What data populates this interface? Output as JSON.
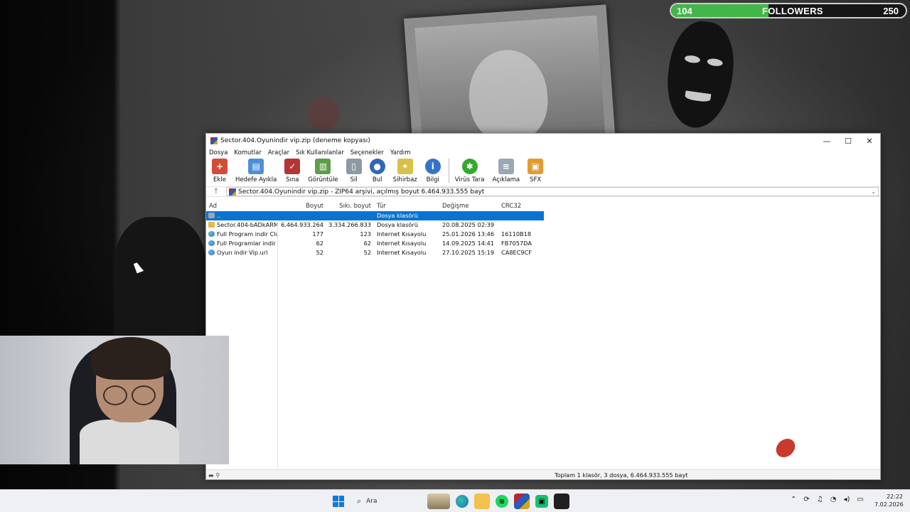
{
  "follower_bar": {
    "current": "104",
    "label": "FOLLOWERS",
    "goal": "250",
    "progress_fraction": 0.416
  },
  "window": {
    "title": "Sector.404.Oyunindir vip.zip (deneme kopyası)",
    "controls": {
      "minimize": "—",
      "maximize": "☐",
      "close": "✕"
    }
  },
  "menu": [
    "Dosya",
    "Komutlar",
    "Araçlar",
    "Sık Kullanılanlar",
    "Seçenekler",
    "Yardım"
  ],
  "toolbar": [
    {
      "label": "Ekle",
      "icon": "add-archive-icon",
      "color": "#d44b36"
    },
    {
      "label": "Hedefe Ayıkla",
      "icon": "extract-folder-icon",
      "color": "#4f8fd8"
    },
    {
      "label": "Sına",
      "icon": "test-clipboard-icon",
      "color": "#b63434"
    },
    {
      "label": "Görüntüle",
      "icon": "view-book-icon",
      "color": "#5c9e4a"
    },
    {
      "label": "Sil",
      "icon": "trash-icon",
      "color": "#8d9aa6"
    },
    {
      "label": "Bul",
      "icon": "find-magnifier-icon",
      "color": "#2f67b8"
    },
    {
      "label": "Sihirbaz",
      "icon": "wizard-wand-icon",
      "color": "#d8c04a"
    },
    {
      "label": "Bilgi",
      "icon": "info-icon",
      "color": "#3574c7"
    },
    {
      "label": "Virüs Tara",
      "icon": "virus-scan-icon",
      "color": "#35a82f"
    },
    {
      "label": "Açıklama",
      "icon": "comment-icon",
      "color": "#9aa8b6"
    },
    {
      "label": "SFX",
      "icon": "sfx-box-icon",
      "color": "#e39b2f"
    }
  ],
  "address": "Sector.404.Oyunindir vip.zip - ZIP64 arşivi, açılmış boyut 6.464.933.555 bayt",
  "columns": {
    "name": "Ad",
    "size": "Boyut",
    "packed": "Sıkı. boyut",
    "type": "Tür",
    "modified": "Değişme",
    "crc": "CRC32"
  },
  "files": [
    {
      "name": "..",
      "size": "",
      "packed": "",
      "type": "Dosya klasörü",
      "modified": "",
      "crc": "",
      "icon": "folder-up",
      "selected": true
    },
    {
      "name": "Sector.404-bADkARMA",
      "size": "6.464.933.264",
      "packed": "3.334.266.833",
      "type": "Dosya klasörü",
      "modified": "20.08.2025 02:39",
      "crc": "",
      "icon": "folder",
      "selected": false
    },
    {
      "name": "Full Program indir Clu...",
      "size": "177",
      "packed": "123",
      "type": "Internet Kısayolu",
      "modified": "25.01.2026 13:46",
      "crc": "16110B18",
      "icon": "url",
      "selected": false
    },
    {
      "name": "Full Programlar indir ...",
      "size": "62",
      "packed": "62",
      "type": "Internet Kısayolu",
      "modified": "14.09.2025 14:41",
      "crc": "FB7057DA",
      "icon": "url",
      "selected": false
    },
    {
      "name": "Oyun indir Vip.url",
      "size": "52",
      "packed": "52",
      "type": "Internet Kısayolu",
      "modified": "27.10.2025 15:19",
      "crc": "CA8EC9CF",
      "icon": "url",
      "selected": false
    }
  ],
  "status": "Toplam 1 klasör, 3 dosya, 6.464.933.555 bayt",
  "taskbar": {
    "search_placeholder": "Ara",
    "time": "22:22",
    "date": "7.02.2026"
  }
}
